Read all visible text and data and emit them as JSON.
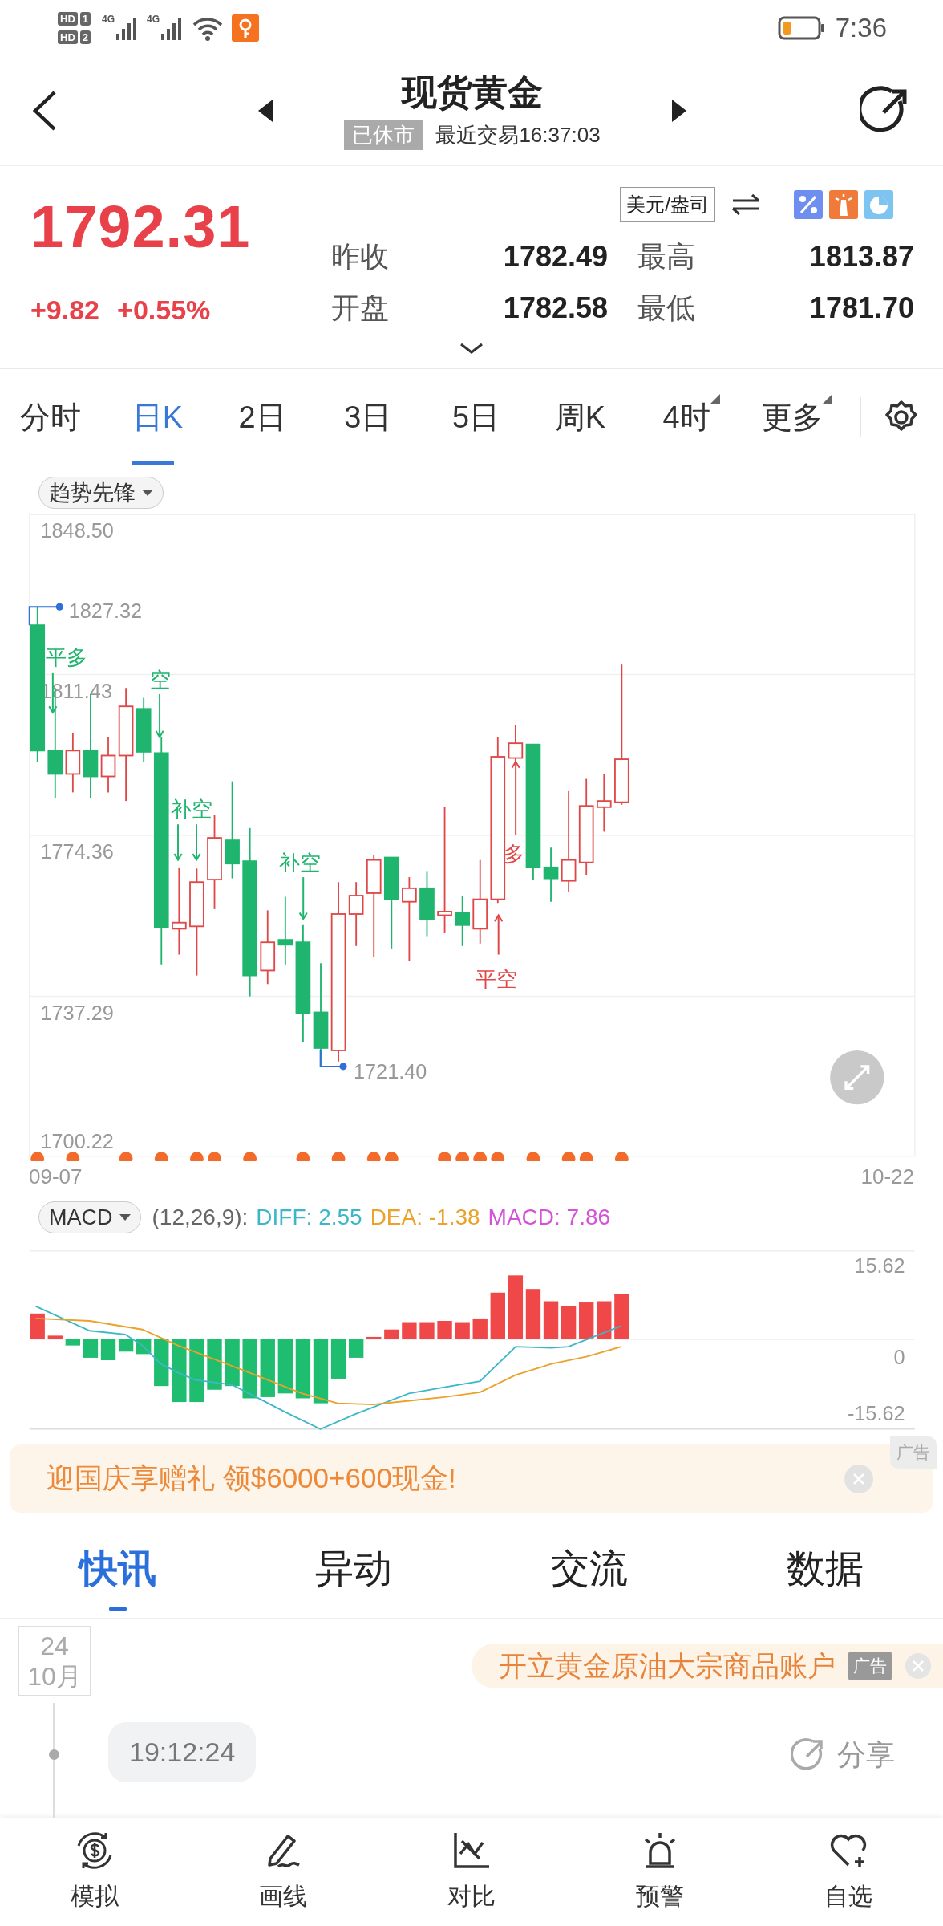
{
  "status_bar": {
    "sims": [
      {
        "label": "HD",
        "slot": "1"
      },
      {
        "label": "HD",
        "slot": "2"
      }
    ],
    "networks": [
      "4G",
      "4G"
    ],
    "time": "7:36"
  },
  "header": {
    "title": "现货黄金",
    "market_status": "已休市",
    "last_trade": "最近交易16:37:03"
  },
  "quote": {
    "price": "1792.31",
    "change": "+9.82",
    "change_pct": "+0.55%",
    "unit": "美元/盎司",
    "stats": [
      {
        "label": "昨收",
        "value": "1782.49"
      },
      {
        "label": "最高",
        "value": "1813.87"
      },
      {
        "label": "开盘",
        "value": "1782.58"
      },
      {
        "label": "最低",
        "value": "1781.70"
      }
    ]
  },
  "period_tabs": [
    {
      "label": "分时",
      "selected": false,
      "has_menu": false
    },
    {
      "label": "日K",
      "selected": true,
      "has_menu": false
    },
    {
      "label": "2日",
      "selected": false,
      "has_menu": false
    },
    {
      "label": "3日",
      "selected": false,
      "has_menu": false
    },
    {
      "label": "5日",
      "selected": false,
      "has_menu": false
    },
    {
      "label": "周K",
      "selected": false,
      "has_menu": false
    },
    {
      "label": "4时",
      "selected": false,
      "has_menu": true
    },
    {
      "label": "更多",
      "selected": false,
      "has_menu": true
    }
  ],
  "kline": {
    "indicator": "趋势先锋",
    "y_labels": [
      "1848.50",
      "1811.43",
      "1774.36",
      "1737.29",
      "1700.22"
    ],
    "x_labels": [
      "09-07",
      "10-22"
    ],
    "high_marker": "1827.32",
    "low_marker": "1721.40",
    "signals": [
      {
        "label": "平多",
        "color": "#1fb56e"
      },
      {
        "label": "空",
        "color": "#1fb56e"
      },
      {
        "label": "补空",
        "color": "#1fb56e"
      },
      {
        "label": "补空",
        "color": "#1fb56e"
      },
      {
        "label": "多",
        "color": "#e04848"
      },
      {
        "label": "平空",
        "color": "#e04848"
      }
    ]
  },
  "macd": {
    "indicator": "MACD",
    "params": "(12,26,9):",
    "values": [
      {
        "text": "DIFF: 2.55",
        "color": "#3db7c8"
      },
      {
        "text": "DEA: -1.38",
        "color": "#eba12a"
      },
      {
        "text": "MACD: 7.86",
        "color": "#d452d8"
      }
    ],
    "y_labels": [
      "15.62",
      "0",
      "-15.62"
    ]
  },
  "promo": {
    "text": "迎国庆享赠礼 领$6000+600现金!",
    "tag": "广告"
  },
  "news_tabs": [
    {
      "label": "快讯",
      "selected": true
    },
    {
      "label": "异动",
      "selected": false
    },
    {
      "label": "交流",
      "selected": false
    },
    {
      "label": "数据",
      "selected": false
    }
  ],
  "feed": {
    "date_day": "24",
    "date_month": "10月",
    "ad_text": "开立黄金原油大宗商品账户",
    "ad_tag": "广告",
    "time": "19:12:24",
    "share": "分享"
  },
  "bottom_nav": [
    {
      "label": "模拟",
      "kind": "simulate"
    },
    {
      "label": "画线",
      "kind": "draw"
    },
    {
      "label": "对比",
      "kind": "compare"
    },
    {
      "label": "预警",
      "kind": "alert"
    },
    {
      "label": "自选",
      "kind": "watchlist"
    }
  ]
}
